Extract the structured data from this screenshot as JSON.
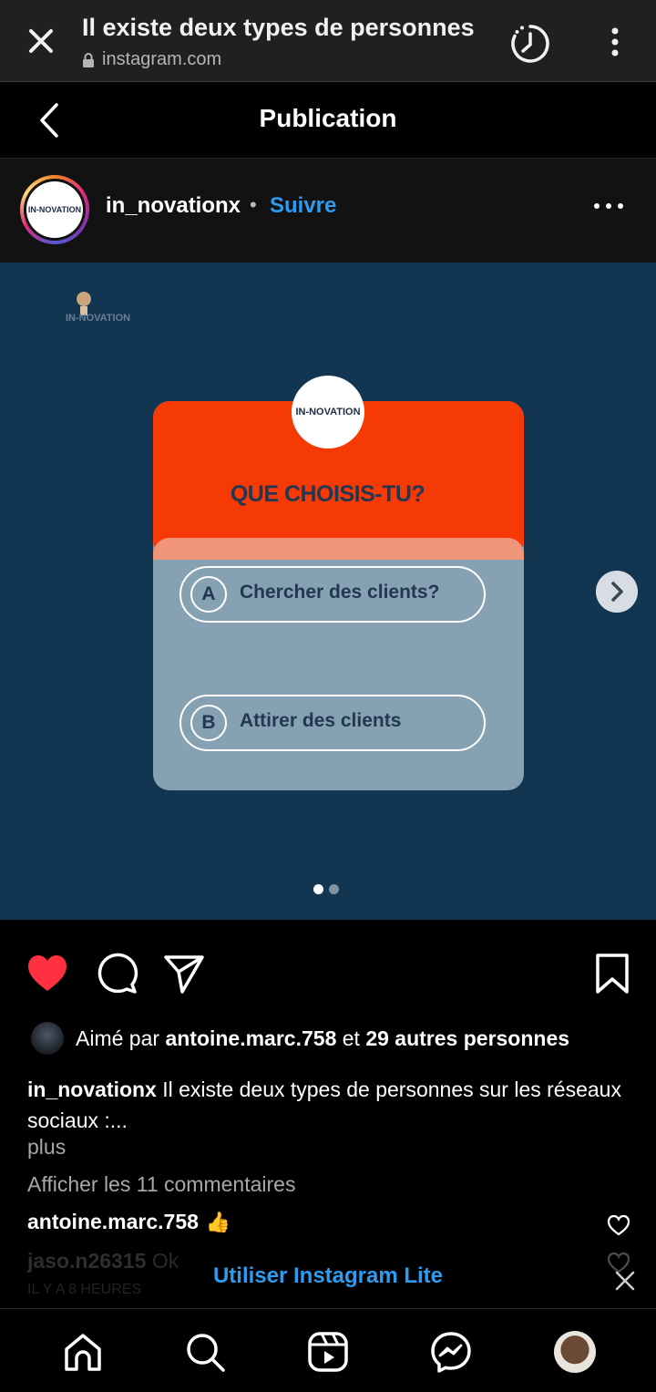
{
  "browser": {
    "title": "Il existe deux types de personnes",
    "url": "instagram.com"
  },
  "header": {
    "title": "Publication"
  },
  "post": {
    "username": "in_novationx",
    "separator": "•",
    "follow_label": "Suivre",
    "avatar_logo_text": "IN-NOVATION",
    "image": {
      "logo_text": "IN-NOVATION",
      "question": "QUE CHOISIS-TU?",
      "options": [
        {
          "letter": "A",
          "text": "Chercher des clients?"
        },
        {
          "letter": "B",
          "text": "Attirer des clients"
        }
      ],
      "page_count": 2,
      "current_page": 1,
      "colors": {
        "background": "#123652",
        "card_top": "#f53a05",
        "card_body": "#86a1b2",
        "text": "#213752"
      }
    }
  },
  "actions": {
    "liked": true,
    "icons": [
      "heart-icon",
      "comment-icon",
      "share-icon",
      "bookmark-icon"
    ]
  },
  "likes": {
    "prefix": "Aimé par",
    "user": "antoine.marc.758",
    "middle": "et",
    "others": "29 autres personnes"
  },
  "caption": {
    "username": "in_novationx",
    "text": "Il existe deux types de personnes sur les réseaux sociaux :...",
    "more": "plus"
  },
  "comments": {
    "view_all": "Afficher les 11 commentaires",
    "items": [
      {
        "username": "antoine.marc.758",
        "text": "👍"
      },
      {
        "username": "jaso.n26315",
        "text": "Ok"
      }
    ],
    "time_ago": "IL Y A 8 HEURES"
  },
  "banner": {
    "label": "Utiliser Instagram Lite"
  },
  "nav": {
    "icons": [
      "home-icon",
      "search-icon",
      "reels-icon",
      "messenger-icon",
      "profile-avatar"
    ]
  }
}
